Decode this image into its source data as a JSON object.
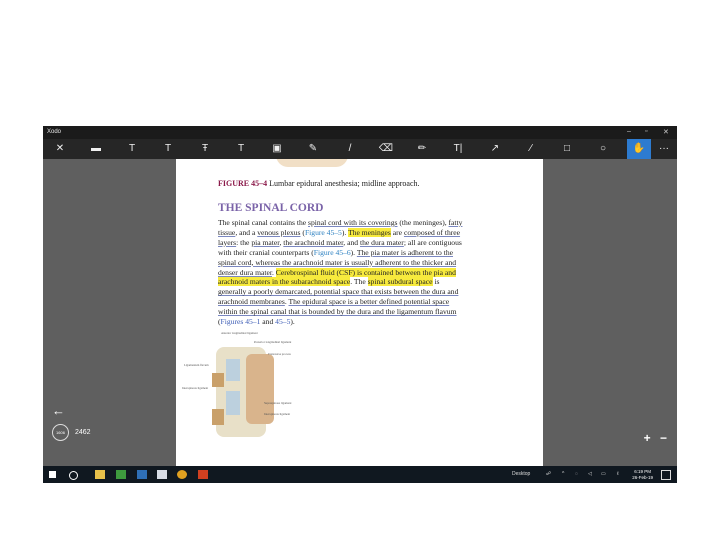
{
  "window": {
    "title": "Xodo",
    "controls": [
      "–",
      "▫",
      "✕"
    ]
  },
  "toolbar": {
    "buttons": [
      {
        "name": "close-doc-button",
        "glyph": "✕"
      },
      {
        "name": "comment-tool-button",
        "glyph": "▬"
      },
      {
        "name": "text-box-tool-button",
        "glyph": "T"
      },
      {
        "name": "highlight-text-tool-button",
        "glyph": "T"
      },
      {
        "name": "strikeout-tool-button",
        "glyph": "Ŧ"
      },
      {
        "name": "underline-tool-button",
        "glyph": "T"
      },
      {
        "name": "image-tool-button",
        "glyph": "▣"
      },
      {
        "name": "edit-tool-button",
        "glyph": "✎"
      },
      {
        "name": "pen-tool-button",
        "glyph": "/"
      },
      {
        "name": "eraser-tool-button",
        "glyph": "⌫"
      },
      {
        "name": "marker-tool-button",
        "glyph": "✏"
      },
      {
        "name": "free-text-tool-button",
        "glyph": "T|"
      },
      {
        "name": "arrow-tool-button",
        "glyph": "↗"
      },
      {
        "name": "line-tool-button",
        "glyph": "∕"
      },
      {
        "name": "rectangle-tool-button",
        "glyph": "□"
      },
      {
        "name": "ellipse-tool-button",
        "glyph": "○"
      },
      {
        "name": "pan-tool-button",
        "glyph": "✋"
      },
      {
        "name": "more-button",
        "glyph": "···"
      }
    ]
  },
  "document": {
    "caption_label": "FIGURE 45–4",
    "caption_text": "Lumbar epidural anesthesia; midline approach.",
    "heading": "THE SPINAL CORD",
    "lines": [
      [
        {
          "t": "The spinal canal contains the "
        },
        {
          "t": "spinal cord with its coverings",
          "c": "ul"
        },
        {
          "t": " (the meninges), "
        },
        {
          "t": "fatty",
          "c": "ul"
        }
      ],
      [
        {
          "t": "tissue",
          "c": "ul"
        },
        {
          "t": ", and a "
        },
        {
          "t": "venous plexus",
          "c": "ul"
        },
        {
          "t": " ("
        },
        {
          "t": "Figure 45–5",
          "c": "blue"
        },
        {
          "t": "). "
        },
        {
          "t": "The meninges",
          "c": "hl"
        },
        {
          "t": " are "
        },
        {
          "t": "composed of three",
          "c": "ul"
        }
      ],
      [
        {
          "t": "layers",
          "c": "ul"
        },
        {
          "t": ": the "
        },
        {
          "t": "pia mater",
          "c": "ul"
        },
        {
          "t": ", "
        },
        {
          "t": "the arachnoid mater",
          "c": "ul"
        },
        {
          "t": ", and "
        },
        {
          "t": "the dura mater",
          "c": "ul"
        },
        {
          "t": "; all are contiguous"
        }
      ],
      [
        {
          "t": "with their cranial counterparts ("
        },
        {
          "t": "Figure 45–6",
          "c": "blue"
        },
        {
          "t": "). "
        },
        {
          "t": "The pia mater is adherent to the",
          "c": "ul"
        }
      ],
      [
        {
          "t": "spinal cord, whereas the arachnoid mater is usually adherent to the thicker and",
          "c": "ul"
        }
      ],
      [
        {
          "t": "denser dura mater",
          "c": "ul"
        },
        {
          "t": ". "
        },
        {
          "t": "Cerebrospinal fluid (CSF) is contained between the pia and",
          "c": "hl"
        }
      ],
      [
        {
          "t": "arachnoid maters in the subarachnoid space",
          "c": "hl"
        },
        {
          "t": ". The "
        },
        {
          "t": "spinal subdural space",
          "c": "hl"
        },
        {
          "t": " is"
        }
      ],
      [
        {
          "t": "generally a poorly demarcated, potential space that exists between the dura and",
          "c": "ul"
        }
      ],
      [
        {
          "t": "arachnoid membranes",
          "c": "ul"
        },
        {
          "t": ". "
        },
        {
          "t": "The epidural space is a better defined potential space",
          "c": "ul"
        }
      ],
      [
        {
          "t": "within the spinal canal that is bounded by the dura and the ligamentum flavum",
          "c": "ul"
        }
      ],
      [
        {
          "t": "("
        },
        {
          "t": "Figures 45–1",
          "c": "blue2"
        },
        {
          "t": " and "
        },
        {
          "t": "45–5",
          "c": "blue2"
        },
        {
          "t": ")."
        }
      ]
    ],
    "figure_labels": {
      "anterior": "Anterior longitudinal ligament",
      "posterior": "Posterior longitudinal ligament",
      "transverse": "Transverse process",
      "flavum": "Ligamentum flavum",
      "interspinous_left": "Interspinous ligament",
      "supraspinous": "Supraspinous ligament",
      "interspinous_right": "Interspinous ligament"
    }
  },
  "viewer": {
    "page_badge": "1606",
    "page_number": "2462",
    "zoom_in": "+",
    "zoom_out": "−",
    "back_glyph": "←"
  },
  "taskbar": {
    "desktop_label": "Desktop",
    "time": "6:19 PM",
    "date": "26-Feb-19"
  }
}
